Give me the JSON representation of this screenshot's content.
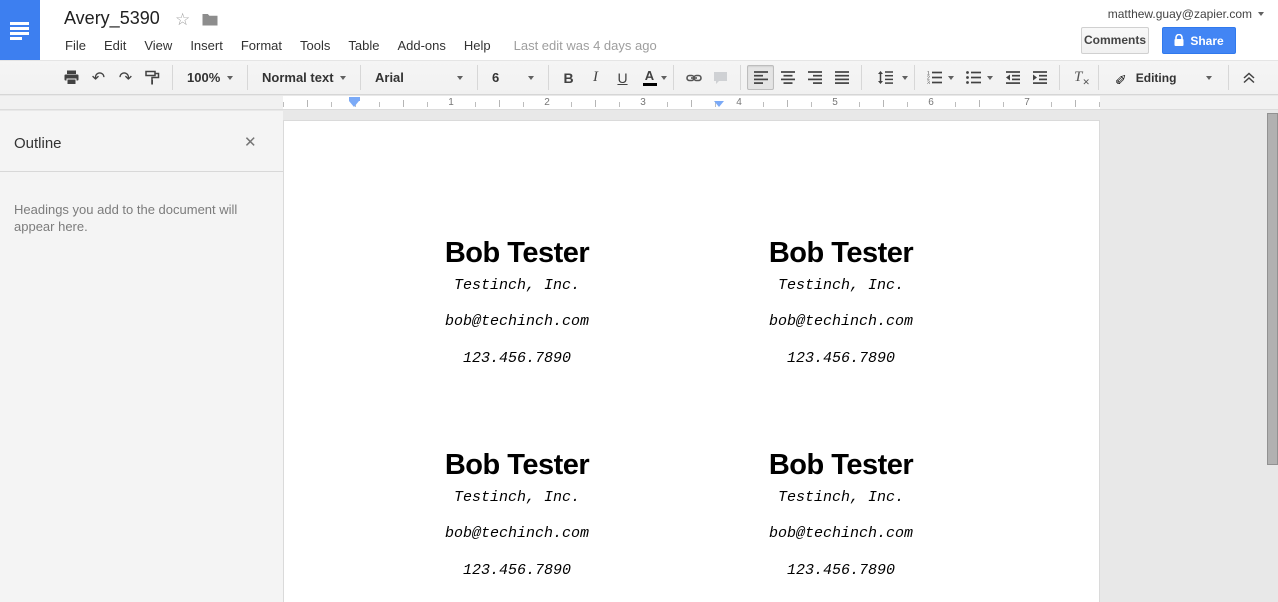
{
  "header": {
    "title": "Avery_5390",
    "menus": [
      "File",
      "Edit",
      "View",
      "Insert",
      "Format",
      "Tools",
      "Table",
      "Add-ons",
      "Help"
    ],
    "last_edit": "Last edit was 4 days ago",
    "account_email": "matthew.guay@zapier.com",
    "comments_label": "Comments",
    "share_label": "Share"
  },
  "toolbar": {
    "zoom_value": "100%",
    "paragraph_style": "Normal text",
    "font_family": "Arial",
    "font_size": "6",
    "bold_label": "B",
    "italic_label": "I",
    "underline_label": "U",
    "text_color_label": "A",
    "clear_formatting_label": "T",
    "clear_formatting_sub": "✕",
    "mode_label": "Editing"
  },
  "ruler": {
    "numbers": [
      "1",
      "2",
      "3",
      "4",
      "5",
      "6",
      "7"
    ]
  },
  "outline": {
    "title": "Outline",
    "empty_message": "Headings you add to the document will appear here."
  },
  "icons": {
    "star": "☆",
    "undo": "↶",
    "redo": "↷",
    "pencil": "✎",
    "close": "✕"
  },
  "document": {
    "cards": [
      {
        "name": "Bob Tester",
        "company": "Testinch, Inc.",
        "email": "bob@techinch.com",
        "phone": "123.456.7890"
      },
      {
        "name": "Bob Tester",
        "company": "Testinch, Inc.",
        "email": "bob@techinch.com",
        "phone": "123.456.7890"
      },
      {
        "name": "Bob Tester",
        "company": "Testinch, Inc.",
        "email": "bob@techinch.com",
        "phone": "123.456.7890"
      },
      {
        "name": "Bob Tester",
        "company": "Testinch, Inc.",
        "email": "bob@techinch.com",
        "phone": "123.456.7890"
      }
    ]
  },
  "colors": {
    "accent_blue": "#4285f4",
    "docs_icon_blue": "#3d7ff0",
    "ruler_marker_blue": "#7baaf7"
  }
}
